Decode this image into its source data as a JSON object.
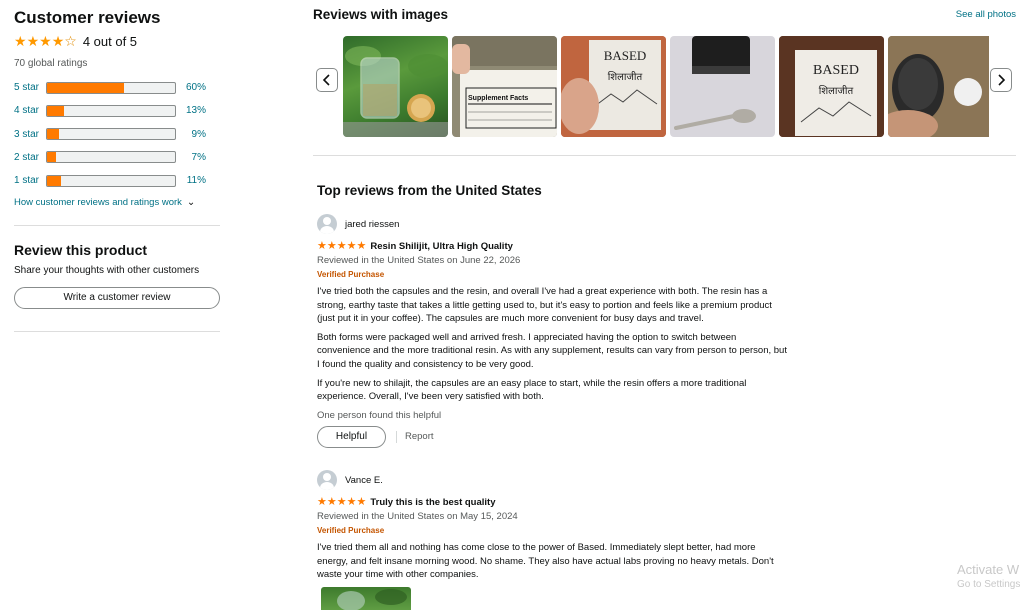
{
  "summary": {
    "title": "Customer reviews",
    "average_text": "4 out of 5",
    "average_rating": 4,
    "global_ratings": "70 global ratings",
    "histogram": [
      {
        "label": "5 star",
        "percent_text": "60%",
        "percent": 60
      },
      {
        "label": "4 star",
        "percent_text": "13%",
        "percent": 13
      },
      {
        "label": "3 star",
        "percent_text": "9%",
        "percent": 9
      },
      {
        "label": "2 star",
        "percent_text": "7%",
        "percent": 7
      },
      {
        "label": "1 star",
        "percent_text": "11%",
        "percent": 11
      }
    ],
    "how_link": "How customer reviews and ratings work"
  },
  "review_product": {
    "title": "Review this product",
    "subtitle": "Share your thoughts with other customers",
    "button": "Write a customer review"
  },
  "images_section": {
    "title": "Reviews with images",
    "see_all": "See all photos",
    "prev_icon": "chevron-left-icon",
    "next_icon": "chevron-right-icon",
    "thumbnails": [
      {
        "name": "glass-of-water-with-jar-photo"
      },
      {
        "name": "supplement-facts-label-photo",
        "text": "Supplement Facts"
      },
      {
        "name": "based-box-in-hand-photo",
        "text": "BASED",
        "subtext": "शिलाजीत"
      },
      {
        "name": "jar-and-spoon-photo"
      },
      {
        "name": "based-box-on-table-photo",
        "text": "BASED",
        "subtext": "शिलाजीत"
      },
      {
        "name": "open-jar-in-hand-photo"
      }
    ]
  },
  "top_reviews": {
    "title": "Top reviews from the United States",
    "reviews": [
      {
        "author": "jared riessen",
        "rating": 5,
        "title": "Resin Shilijit, Ultra High Quality",
        "date": "Reviewed in the United States on June 22, 2026",
        "verified": "Verified Purchase",
        "paragraphs": [
          "I've tried both the capsules and the resin, and overall I've had a great experience with both. The resin has a strong, earthy taste that takes a little getting used to, but it's easy to portion and feels like a premium product (just put it in your coffee). The capsules are much more convenient for busy days and travel.",
          "Both forms were packaged well and arrived fresh. I appreciated having the option to switch between convenience and the more traditional resin. As with any supplement, results can vary from person to person, but I found the quality and consistency to be very good.",
          "If you're new to shilajit, the capsules are an easy place to start, while the resin offers a more traditional experience. Overall, I've been very satisfied with both."
        ],
        "found_helpful": "One person found this helpful",
        "helpful_label": "Helpful",
        "report_label": "Report"
      },
      {
        "author": "Vance E.",
        "rating": 5,
        "title": "Truly this is the best quality",
        "date": "Reviewed in the United States on May 15, 2024",
        "verified": "Verified Purchase",
        "paragraphs": [
          "I've tried them all and nothing has come close to the power of Based. Immediately slept better, had more energy, and felt insane morning wood. No shame. They also have actual labs proving no heavy metals. Don't waste your time with other companies."
        ]
      }
    ]
  },
  "watermark": {
    "line1": "Activate W",
    "line2": "Go to Settings"
  },
  "colors": {
    "link": "#007185",
    "star": "#ff9900",
    "bar_fill": "#ff7a00",
    "verified": "#c45500"
  }
}
